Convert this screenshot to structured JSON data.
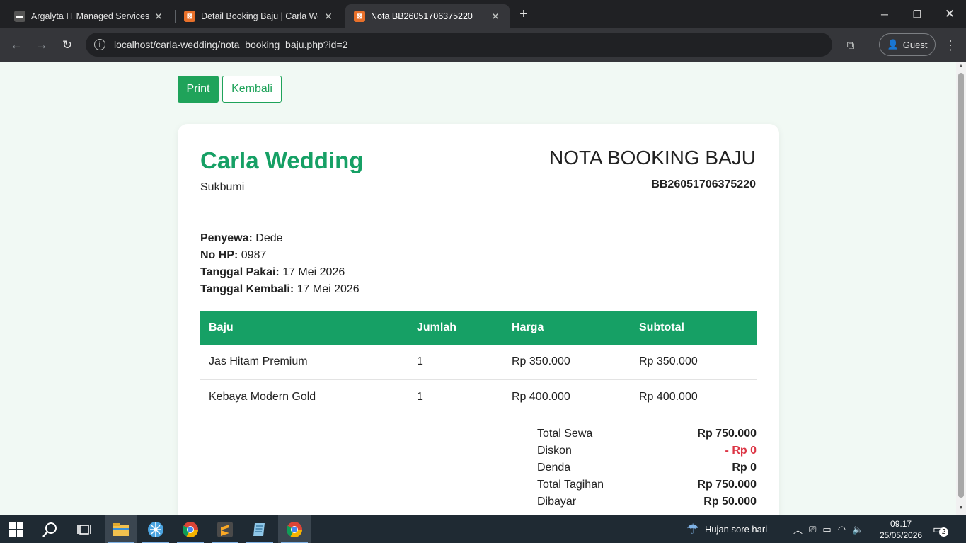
{
  "browser": {
    "tabs": [
      {
        "title": "Argalyta IT Managed Services &",
        "active": false
      },
      {
        "title": "Detail Booking Baju | Carla Wedding",
        "active": false
      },
      {
        "title": "Nota BB26051706375220",
        "active": true
      }
    ],
    "url": "localhost/carla-wedding/nota_booking_baju.php?id=2",
    "profile_label": "Guest"
  },
  "page": {
    "print_label": "Print",
    "back_label": "Kembali",
    "brand": "Carla Wedding",
    "city": "Sukbumi",
    "doc_title": "NOTA BOOKING BAJU",
    "doc_number": "BB26051706375220",
    "info": [
      {
        "label": "Penyewa:",
        "value": "Dede"
      },
      {
        "label": "No HP:",
        "value": "0987"
      },
      {
        "label": "Tanggal Pakai:",
        "value": "17 Mei 2026"
      },
      {
        "label": "Tanggal Kembali:",
        "value": "17 Mei 2026"
      }
    ],
    "table": {
      "headers": [
        "Baju",
        "Jumlah",
        "Harga",
        "Subtotal"
      ],
      "rows": [
        [
          "Jas Hitam Premium",
          "1",
          "Rp 350.000",
          "Rp 350.000"
        ],
        [
          "Kebaya Modern Gold",
          "1",
          "Rp 400.000",
          "Rp 400.000"
        ]
      ]
    },
    "summary": [
      {
        "label": "Total Sewa",
        "value": "Rp 750.000"
      },
      {
        "label": "Diskon",
        "value": "- Rp 0"
      },
      {
        "label": "Denda",
        "value": "Rp 0"
      },
      {
        "label": "Total Tagihan",
        "value": "Rp 750.000"
      },
      {
        "label": "Dibayar",
        "value": "Rp 50.000"
      }
    ]
  },
  "taskbar": {
    "weather": "Hujan sore hari",
    "time": "09.17",
    "date": "25/05/2026",
    "notifications": "2"
  },
  "colors": {
    "accent": "#16a065",
    "danger": "#dc3545",
    "page_bg": "#f1f9f4"
  }
}
